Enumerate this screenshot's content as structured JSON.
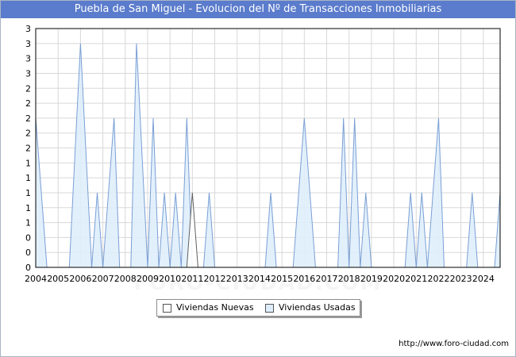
{
  "title": "Puebla de San Miguel - Evolucion del Nº de Transacciones Inmobiliarias",
  "watermark": "FORO-CIUDAD.COM",
  "source": "http://www.foro-ciudad.com",
  "colors": {
    "title_bg": "#5b7ccc",
    "nuevas_fill": "#ffffff",
    "nuevas_line": "#606060",
    "usadas_fill": "#dfeefc",
    "usadas_line": "#7a9fd4",
    "grid": "#d8d8d8"
  },
  "chart_data": {
    "type": "area",
    "title": "Puebla de San Miguel - Evolucion del Nº de Transacciones Inmobiliarias",
    "xlabel": "",
    "ylabel": "",
    "x_range": [
      2004.0,
      2024.75
    ],
    "ylim": [
      0,
      3.2
    ],
    "y_tick_labels": [
      "0",
      "0",
      "0",
      "1",
      "1",
      "1",
      "1",
      "1",
      "2",
      "2",
      "2",
      "2",
      "2",
      "3",
      "3",
      "3",
      "3"
    ],
    "x_tick_labels": [
      "2004",
      "2005",
      "2006",
      "2007",
      "2008",
      "2009",
      "2010",
      "2011",
      "2012",
      "2013",
      "2014",
      "2015",
      "2016",
      "2017",
      "2018",
      "2019",
      "2020",
      "2021",
      "2022",
      "2023",
      "2024"
    ],
    "grid": true,
    "legend_position": "bottom",
    "legend": [
      "Viviendas Nuevas",
      "Viviendas Usadas"
    ],
    "series": [
      {
        "name": "Viviendas Nuevas",
        "points": [
          [
            2010.75,
            0
          ],
          [
            2011.0,
            1
          ],
          [
            2011.25,
            0
          ]
        ]
      },
      {
        "name": "Viviendas Usadas",
        "points": [
          [
            2004.0,
            2
          ],
          [
            2004.5,
            0
          ],
          [
            2005.5,
            0
          ],
          [
            2006.0,
            3
          ],
          [
            2006.5,
            0
          ],
          [
            2006.75,
            1
          ],
          [
            2007.0,
            0
          ],
          [
            2007.5,
            2
          ],
          [
            2007.75,
            0
          ],
          [
            2008.25,
            0
          ],
          [
            2008.5,
            3
          ],
          [
            2009.0,
            0
          ],
          [
            2009.25,
            2
          ],
          [
            2009.5,
            0
          ],
          [
            2009.75,
            1
          ],
          [
            2010.0,
            0
          ],
          [
            2010.25,
            1
          ],
          [
            2010.5,
            0
          ],
          [
            2010.75,
            2
          ],
          [
            2011.0,
            0
          ],
          [
            2011.5,
            0
          ],
          [
            2011.75,
            1
          ],
          [
            2012.0,
            0
          ],
          [
            2014.25,
            0
          ],
          [
            2014.5,
            1
          ],
          [
            2014.75,
            0
          ],
          [
            2015.5,
            0
          ],
          [
            2016.0,
            2
          ],
          [
            2016.5,
            0
          ],
          [
            2017.5,
            0
          ],
          [
            2017.75,
            2
          ],
          [
            2018.0,
            0
          ],
          [
            2018.25,
            2
          ],
          [
            2018.5,
            0
          ],
          [
            2018.75,
            1
          ],
          [
            2019.0,
            0
          ],
          [
            2020.5,
            0
          ],
          [
            2020.75,
            1
          ],
          [
            2021.0,
            0
          ],
          [
            2021.25,
            1
          ],
          [
            2021.5,
            0
          ],
          [
            2022.0,
            2
          ],
          [
            2022.25,
            0
          ],
          [
            2023.25,
            0
          ],
          [
            2023.5,
            1
          ],
          [
            2023.75,
            0
          ],
          [
            2024.5,
            0
          ],
          [
            2024.75,
            1
          ]
        ]
      }
    ]
  }
}
